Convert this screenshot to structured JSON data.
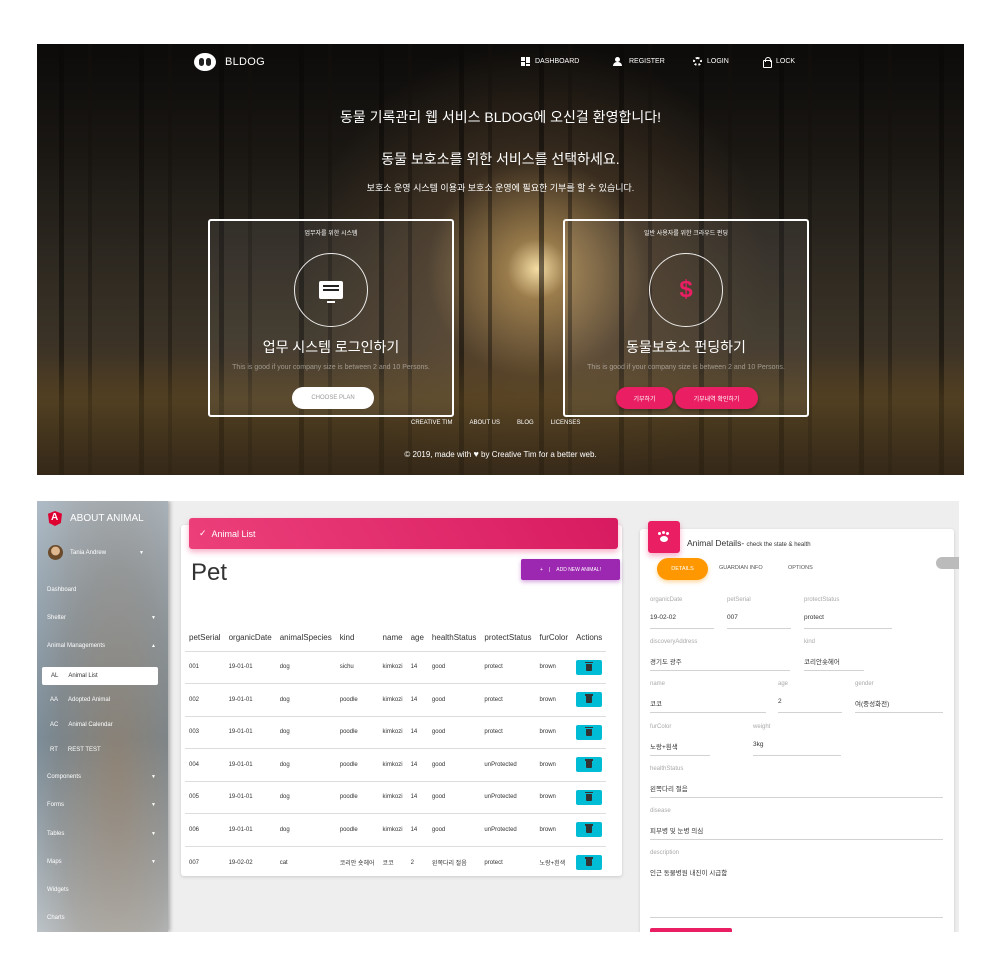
{
  "hero": {
    "brand": "BLDOG",
    "nav": [
      {
        "label": "DASHBOARD",
        "icon": "dashboard-icon"
      },
      {
        "label": "REGISTER",
        "icon": "person-add-icon"
      },
      {
        "label": "LOGIN",
        "icon": "fingerprint-icon"
      },
      {
        "label": "LOCK",
        "icon": "lock-icon"
      }
    ],
    "title1": "동물 기록관리 웹 서비스 BLDOG에 오신걸 환영합니다!",
    "title2": "동물 보호소를 위한 서비스를 선택하세요.",
    "title3": "보호소 운영 시스템 이용과 보호소 운영에 필요한 기부를 할 수 있습니다.",
    "card1": {
      "category": "업무자를 위한 시스템",
      "title": "업무 시스템 로그인하기",
      "desc": "This is good if your company size is between 2 and 10 Persons.",
      "button": "CHOOSE PLAN"
    },
    "card2": {
      "category": "일반 사용자를 위한 크라우드 펀딩",
      "title": "동물보호소 펀딩하기",
      "desc": "This is good if your company size is between 2 and 10 Persons.",
      "button1": "기부하기",
      "button2": "기부내역 확인하기"
    },
    "footer_links": [
      "CREATIVE TIM",
      "ABOUT US",
      "BLOG",
      "LICENSES"
    ],
    "copyright_pre": "© 2019, made with",
    "copyright_post": "by Creative Tim for a better web."
  },
  "sidebar": {
    "logo": "ABOUT ANIMAL",
    "user": "Tania Andrew",
    "items": [
      "Dashboard",
      "Shelter",
      "Animal Managements"
    ],
    "sub_items": [
      {
        "abbr": "AL",
        "label": "Animal List"
      },
      {
        "abbr": "AA",
        "label": "Adopted Animal"
      },
      {
        "abbr": "AC",
        "label": "Animal Calendar"
      },
      {
        "abbr": "RT",
        "label": "REST TEST"
      }
    ],
    "items2": [
      "Components",
      "Forms",
      "Tables",
      "Maps",
      "Widgets",
      "Charts"
    ]
  },
  "animal_list": {
    "header": "Animal List",
    "title": "Pet",
    "add_button": "ADD NEW ANIMAL!",
    "columns": [
      "petSerial",
      "organicDate",
      "animalSpecies",
      "kind",
      "name",
      "age",
      "healthStatus",
      "protectStatus",
      "furColor",
      "Actions"
    ],
    "rows": [
      [
        "001",
        "19-01-01",
        "dog",
        "sichu",
        "kimkozi",
        "14",
        "good",
        "protect",
        "brown"
      ],
      [
        "002",
        "19-01-01",
        "dog",
        "poodle",
        "kimkozi",
        "14",
        "good",
        "protect",
        "brown"
      ],
      [
        "003",
        "19-01-01",
        "dog",
        "poodle",
        "kimkozi",
        "14",
        "good",
        "protect",
        "brown"
      ],
      [
        "004",
        "19-01-01",
        "dog",
        "poodle",
        "kimkozi",
        "14",
        "good",
        "unProtected",
        "brown"
      ],
      [
        "005",
        "19-01-01",
        "dog",
        "poodle",
        "kimkozi",
        "14",
        "good",
        "unProtected",
        "brown"
      ],
      [
        "006",
        "19-01-01",
        "dog",
        "poodle",
        "kimkozi",
        "14",
        "good",
        "unProtected",
        "brown"
      ],
      [
        "007",
        "19-02-02",
        "cat",
        "코리안 숏헤어",
        "코코",
        "2",
        "왼쪽다리 절음",
        "protect",
        "노랑+흰색"
      ]
    ]
  },
  "details": {
    "title": "Animal Details-",
    "subtitle": "check the state & health",
    "tabs": [
      "DETAILS",
      "GUARDIAN INFO",
      "OPTIONS"
    ],
    "fields": {
      "organicDate": {
        "label": "organicDate",
        "value": "19-02-02"
      },
      "petSerial": {
        "label": "petSerial",
        "value": "007"
      },
      "protectStatus": {
        "label": "protectStatus",
        "value": "protect"
      },
      "discoveryAddress": {
        "label": "discoveryAddress",
        "value": "경기도 광주"
      },
      "kind": {
        "label": "kind",
        "value": "코리안숏헤어"
      },
      "name": {
        "label": "name",
        "value": "코코"
      },
      "age": {
        "label": "age",
        "value": "2"
      },
      "gender": {
        "label": "gender",
        "value": "여(중성화전)"
      },
      "furColor": {
        "label": "furColor",
        "value": "노랑+흰색"
      },
      "weight": {
        "label": "weight",
        "value": "3kg"
      },
      "healthStatus": {
        "label": "healthStatus",
        "value": "왼쪽다리 절음"
      },
      "disease": {
        "label": "disease",
        "value": "피부병 및 눈병 의심"
      },
      "description": {
        "label": "description",
        "value": "인근 동물병원 내진이 시급함"
      }
    }
  }
}
